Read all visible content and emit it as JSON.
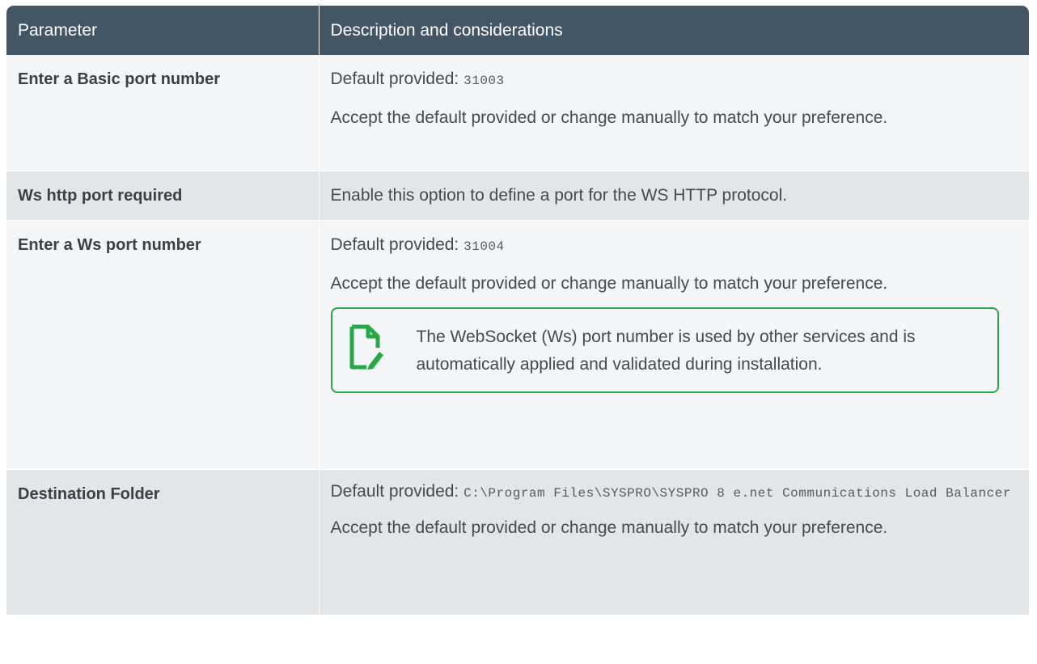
{
  "table": {
    "headers": [
      "Parameter",
      "Description and considerations"
    ],
    "rows": [
      {
        "param": "Enter a Basic port number",
        "default_label": "Default provided:",
        "default_value": "31003",
        "accept_text": "Accept the default provided or change manually to match your preference."
      },
      {
        "param": "Ws http port required",
        "description": "Enable this option to define a port for the WS HTTP protocol."
      },
      {
        "param": "Enter a Ws port number",
        "default_label": "Default provided:",
        "default_value": "31004",
        "accept_text": "Accept the default provided or change manually to match your preference.",
        "note": {
          "icon": "note-edit-icon",
          "color": "#28a745",
          "text": "The WebSocket (Ws) port number is used by other services and is automatically applied and validated during installation."
        }
      },
      {
        "param": "Destination Folder",
        "default_label": "Default provided:",
        "default_value": "C:\\Program Files\\SYSPRO\\SYSPRO 8 e.net Communications Load Balancer",
        "accept_text": "Accept the default provided or change manually to match your preference."
      }
    ]
  },
  "colors": {
    "header_bg": "#435665",
    "row_light": "#f4f5f6",
    "row_dark": "#e3e6e9",
    "note_border": "#28a745"
  }
}
